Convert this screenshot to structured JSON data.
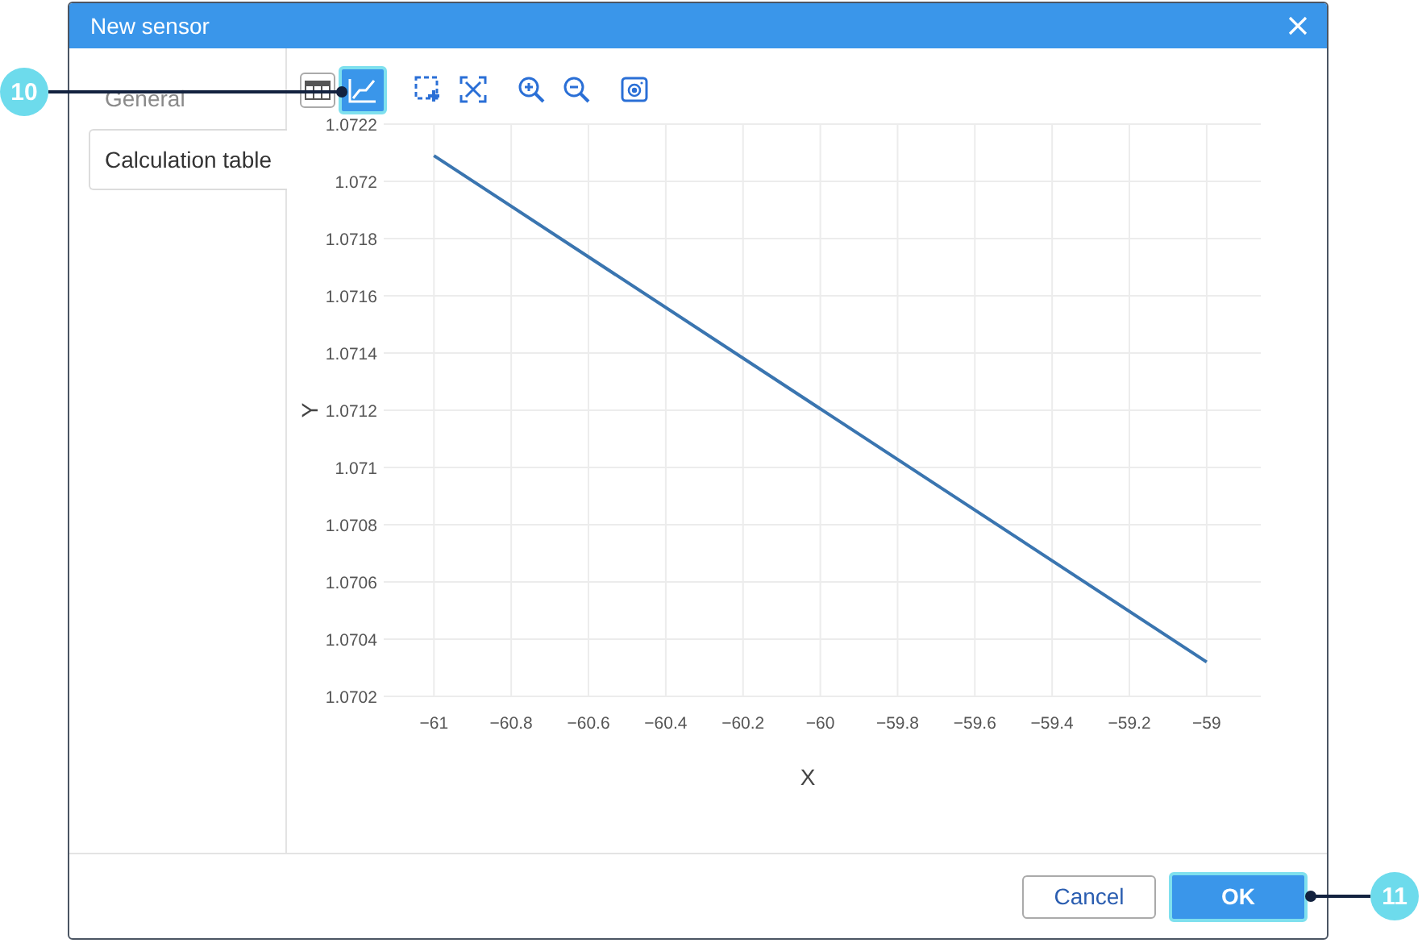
{
  "window": {
    "title": "New sensor"
  },
  "sidebar": {
    "tabs": [
      {
        "label": "General",
        "selected": false
      },
      {
        "label": "Calculation table",
        "selected": true
      }
    ]
  },
  "view_toggle": [
    {
      "kind": "table",
      "selected": false
    },
    {
      "kind": "chart",
      "selected": true
    }
  ],
  "chart_tools": [
    {
      "kind": "select-zoom"
    },
    {
      "kind": "fit"
    },
    {
      "kind": "zoom-in"
    },
    {
      "kind": "zoom-out"
    },
    {
      "kind": "camera"
    }
  ],
  "chart": {
    "chart_data": {
      "type": "line",
      "xlabel": "X",
      "ylabel": "Y",
      "xlim": [
        -61.13,
        -58.86
      ],
      "ylim": [
        1.0702,
        1.0722
      ],
      "x": [
        -61,
        -59
      ],
      "grid": true,
      "series": [
        {
          "color": "#3a75b0",
          "values": [
            1.07209,
            1.07032
          ]
        }
      ],
      "xticks": [
        {
          "value": -61,
          "label": "−61"
        },
        {
          "value": -60.8,
          "label": "−60.8"
        },
        {
          "value": -60.6,
          "label": "−60.6"
        },
        {
          "value": -60.4,
          "label": "−60.4"
        },
        {
          "value": -60.2,
          "label": "−60.2"
        },
        {
          "value": -60,
          "label": "−60"
        },
        {
          "value": -59.8,
          "label": "−59.8"
        },
        {
          "value": -59.6,
          "label": "−59.6"
        },
        {
          "value": -59.4,
          "label": "−59.4"
        },
        {
          "value": -59.2,
          "label": "−59.2"
        },
        {
          "value": -59,
          "label": "−59"
        }
      ],
      "yticks": [
        {
          "value": 1.0702,
          "label": "1.0702"
        },
        {
          "value": 1.0704,
          "label": "1.0704"
        },
        {
          "value": 1.0706,
          "label": "1.0706"
        },
        {
          "value": 1.0708,
          "label": "1.0708"
        },
        {
          "value": 1.071,
          "label": "1.071"
        },
        {
          "value": 1.0712,
          "label": "1.0712"
        },
        {
          "value": 1.0714,
          "label": "1.0714"
        },
        {
          "value": 1.0716,
          "label": "1.0716"
        },
        {
          "value": 1.0718,
          "label": "1.0718"
        },
        {
          "value": 1.072,
          "label": "1.072"
        },
        {
          "value": 1.0722,
          "label": "1.0722"
        }
      ]
    }
  },
  "buttons": [
    {
      "label": "Cancel",
      "kind": "secondary"
    },
    {
      "label": "OK",
      "kind": "primary"
    }
  ],
  "callouts": [
    {
      "label": "10"
    },
    {
      "label": "11"
    }
  ]
}
